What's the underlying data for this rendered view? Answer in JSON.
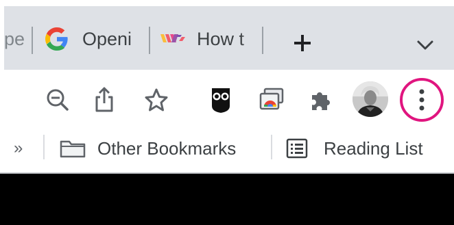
{
  "tabs": [
    {
      "label": "pe",
      "favicon": "partial-tab"
    },
    {
      "label": "Openi",
      "favicon": "google-g-icon"
    },
    {
      "label": "How t",
      "favicon": "wix-logo-icon"
    }
  ],
  "toolbar": {
    "icons": [
      "zoom-out-icon",
      "share-icon",
      "bookmark-star-icon",
      "hootsuite-owl-icon",
      "chrome-cast-icon",
      "extensions-puzzle-icon",
      "profile-avatar",
      "more-menu-icon"
    ],
    "highlight_color": "#e0157f"
  },
  "bookmarks": {
    "chevron": "»",
    "other_label": "Other Bookmarks",
    "reading_label": "Reading List"
  },
  "colors": {
    "tabstrip": "#dee1e6",
    "content": "#000000",
    "icon": "#5f6368"
  }
}
